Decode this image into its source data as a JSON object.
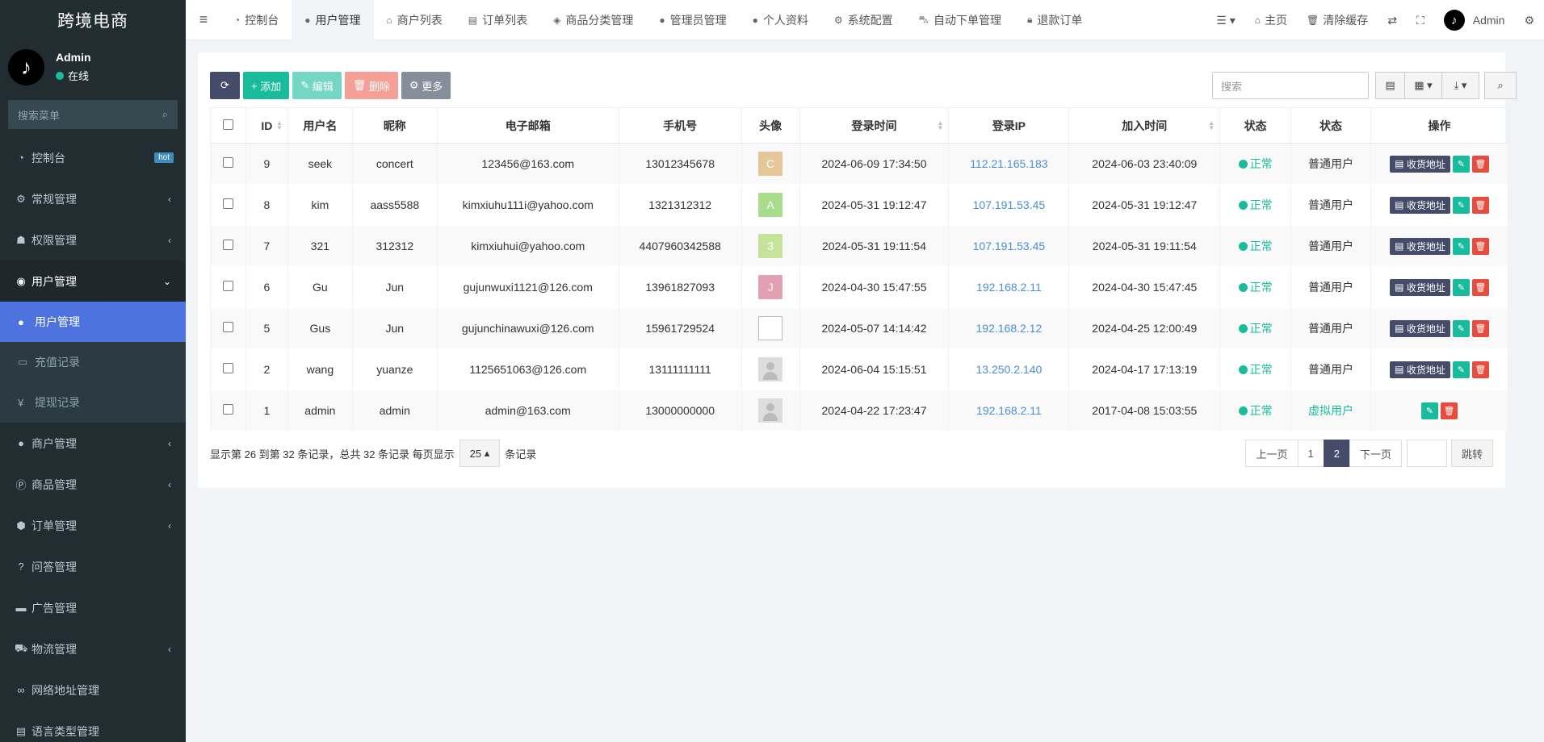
{
  "brand": "跨境电商",
  "user": {
    "name": "Admin",
    "status": "在线"
  },
  "sidebar": {
    "search_placeholder": "搜索菜单",
    "items": [
      {
        "label": "控制台",
        "badge": "hot"
      },
      {
        "label": "常规管理"
      },
      {
        "label": "权限管理"
      },
      {
        "label": "用户管理"
      },
      {
        "label": "用户管理"
      },
      {
        "label": "充值记录"
      },
      {
        "label": "提现记录"
      },
      {
        "label": "商户管理"
      },
      {
        "label": "商品管理"
      },
      {
        "label": "订单管理"
      },
      {
        "label": "问答管理"
      },
      {
        "label": "广告管理"
      },
      {
        "label": "物流管理"
      },
      {
        "label": "网络地址管理"
      },
      {
        "label": "语言类型管理"
      }
    ]
  },
  "topbar": {
    "tabs": [
      "控制台",
      "用户管理",
      "商户列表",
      "订单列表",
      "商品分类管理",
      "管理员管理",
      "个人资料",
      "系统配置",
      "自动下单管理",
      "退款订单"
    ],
    "home": "主页",
    "clear_cache": "清除缓存",
    "admin": "Admin"
  },
  "toolbar": {
    "add": "添加",
    "edit": "编辑",
    "delete": "删除",
    "more": "更多",
    "search_placeholder": "搜索"
  },
  "table": {
    "headers": [
      "ID",
      "用户名",
      "昵称",
      "电子邮箱",
      "手机号",
      "头像",
      "登录时间",
      "登录IP",
      "加入时间",
      "状态",
      "状态",
      "操作"
    ],
    "address_btn": "收货地址",
    "rows": [
      {
        "id": "9",
        "username": "seek",
        "nickname": "concert",
        "email": "123456@163.com",
        "phone": "13012345678",
        "avatar": "C",
        "avatar_color": "#e6c79a",
        "login_time": "2024-06-09 17:34:50",
        "ip": "112.21.165.183",
        "join_time": "2024-06-03 23:40:09",
        "status": "正常",
        "type": "普通用户"
      },
      {
        "id": "8",
        "username": "kim",
        "nickname": "aass5588",
        "email": "kimxiuhu111i@yahoo.com",
        "phone": "1321312312",
        "avatar": "A",
        "avatar_color": "#a6dc8a",
        "login_time": "2024-05-31 19:12:47",
        "ip": "107.191.53.45",
        "join_time": "2024-05-31 19:12:47",
        "status": "正常",
        "type": "普通用户"
      },
      {
        "id": "7",
        "username": "321",
        "nickname": "312312",
        "email": "kimxiuhui@yahoo.com",
        "phone": "4407960342588",
        "avatar": "3",
        "avatar_color": "#c6e39a",
        "login_time": "2024-05-31 19:11:54",
        "ip": "107.191.53.45",
        "join_time": "2024-05-31 19:11:54",
        "status": "正常",
        "type": "普通用户"
      },
      {
        "id": "6",
        "username": "Gu",
        "nickname": "Jun",
        "email": "gujunwuxi1121@126.com",
        "phone": "13961827093",
        "avatar": "J",
        "avatar_color": "#e3a0b2",
        "login_time": "2024-04-30 15:47:55",
        "ip": "192.168.2.11",
        "join_time": "2024-04-30 15:47:45",
        "status": "正常",
        "type": "普通用户"
      },
      {
        "id": "5",
        "username": "Gus",
        "nickname": "Jun",
        "email": "gujunchinawuxi@126.com",
        "phone": "15961729524",
        "avatar": "",
        "avatar_color": "",
        "login_time": "2024-05-07 14:14:42",
        "ip": "192.168.2.12",
        "join_time": "2024-04-25 12:00:49",
        "status": "正常",
        "type": "普通用户"
      },
      {
        "id": "2",
        "username": "wang",
        "nickname": "yuanze",
        "email": "1125651063@126.com",
        "phone": "13111111111",
        "avatar": "",
        "avatar_color": "",
        "login_time": "2024-06-04 15:15:51",
        "ip": "13.250.2.140",
        "join_time": "2024-04-17 17:13:19",
        "status": "正常",
        "type": "普通用户"
      },
      {
        "id": "1",
        "username": "admin",
        "nickname": "admin",
        "email": "admin@163.com",
        "phone": "13000000000",
        "avatar": "",
        "avatar_color": "",
        "login_time": "2024-04-22 17:23:47",
        "ip": "192.168.2.11",
        "join_time": "2017-04-08 15:03:55",
        "status": "正常",
        "type": "虚拟用户"
      }
    ]
  },
  "footer": {
    "info": "显示第 26 到第 32 条记录，总共 32 条记录 每页显示",
    "page_size": "25",
    "suffix": "条记录",
    "prev": "上一页",
    "next": "下一页",
    "pages": [
      "1",
      "2"
    ],
    "current_page": "2",
    "go": "跳转"
  }
}
